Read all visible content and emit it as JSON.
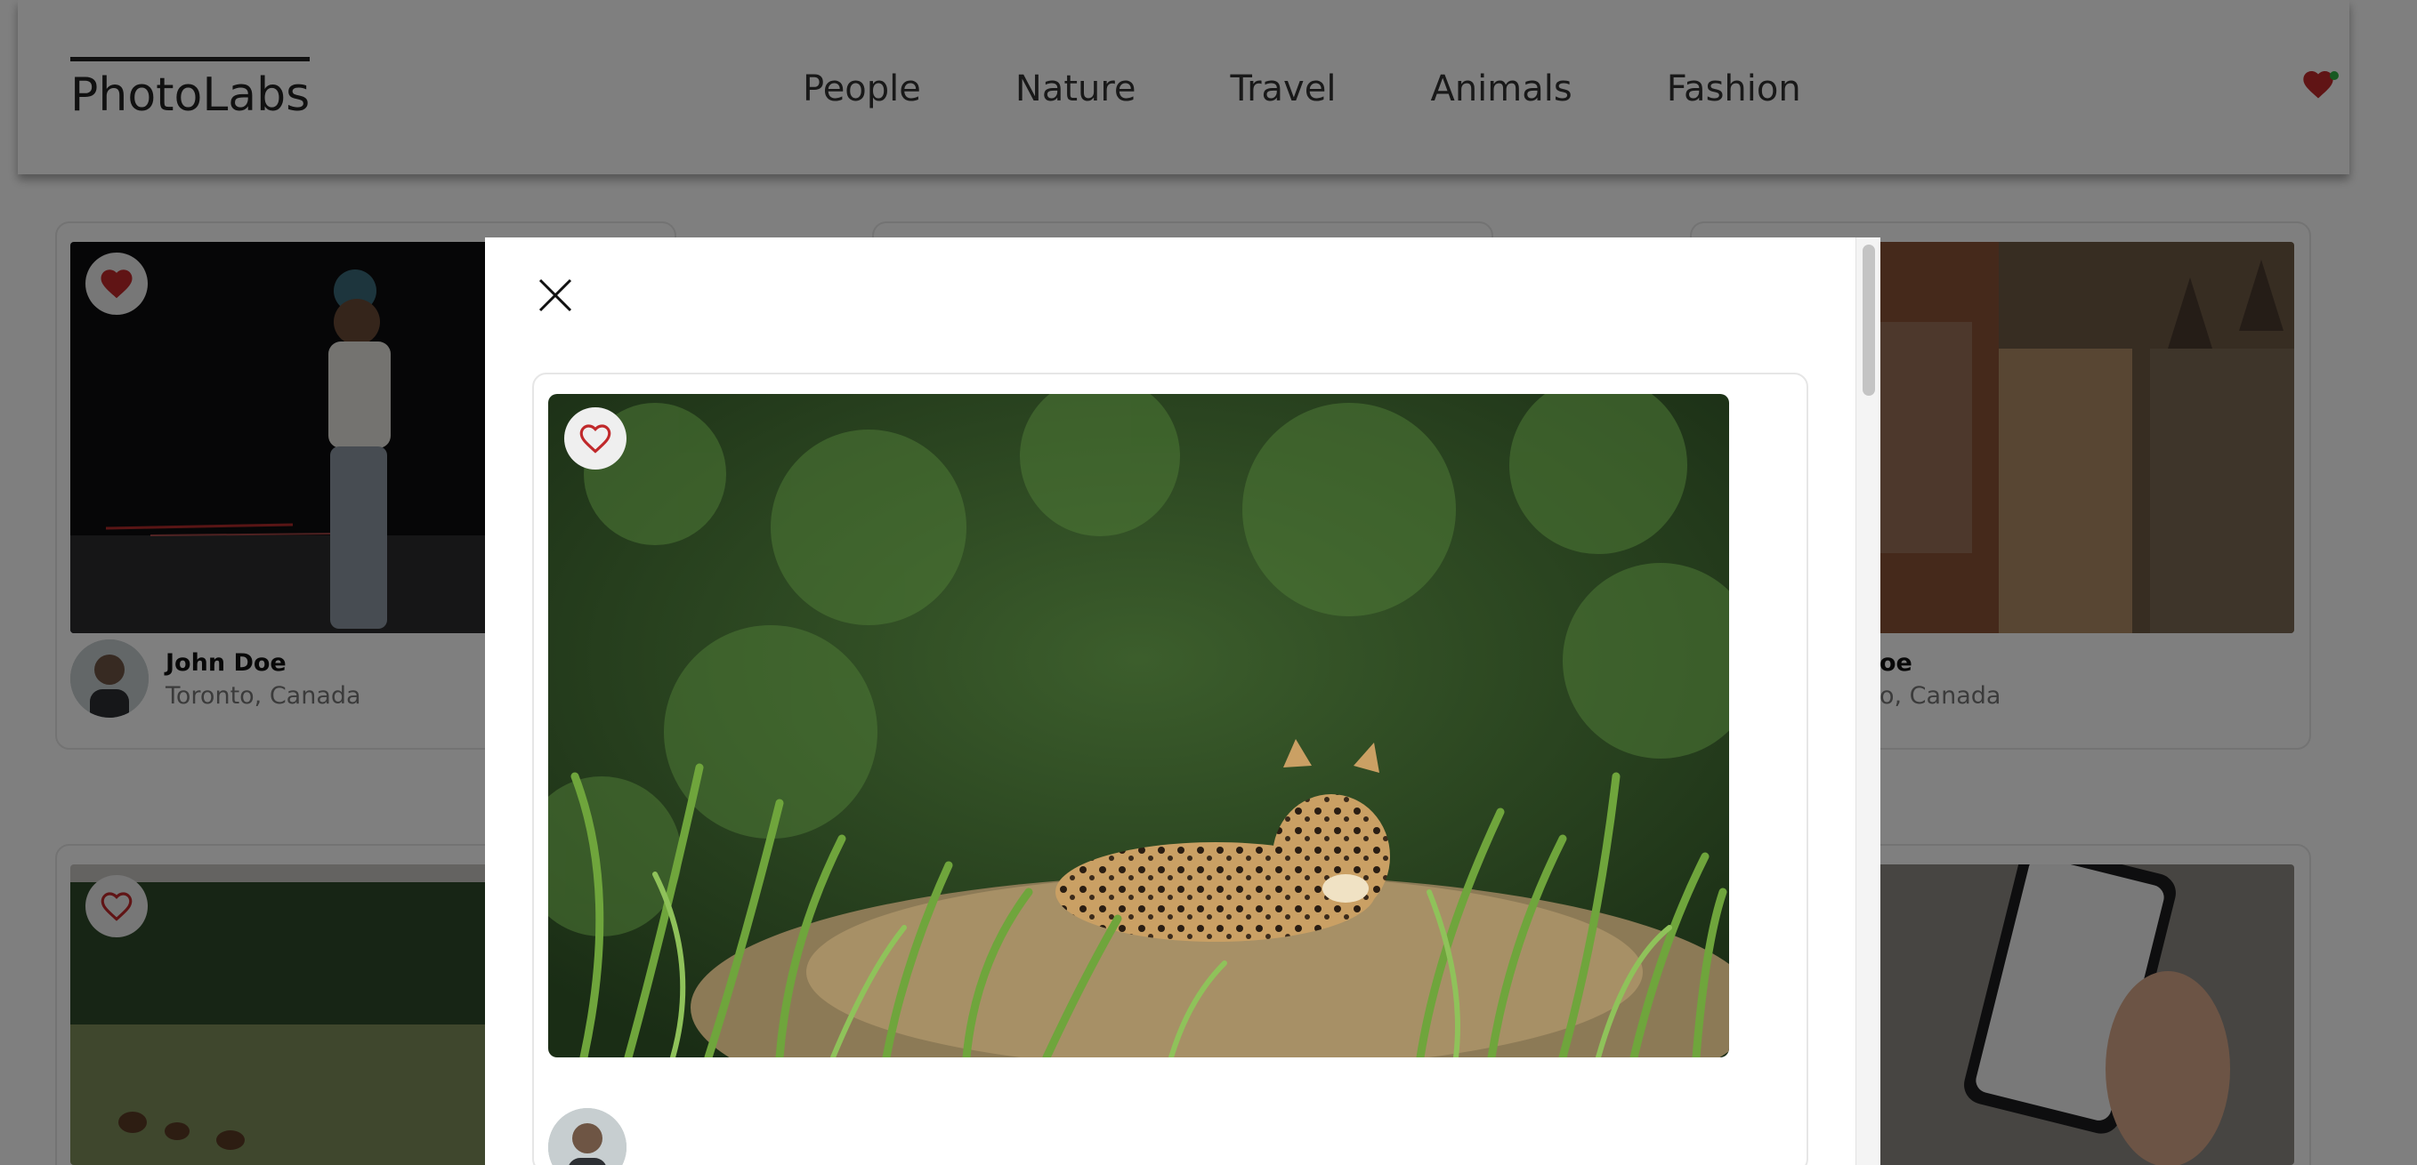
{
  "app": {
    "logo": "PhotoLabs"
  },
  "nav": {
    "topics": [
      "People",
      "Nature",
      "Travel",
      "Animals",
      "Fashion"
    ],
    "fav_icon": "heart-icon",
    "has_notification": true
  },
  "colors": {
    "heart_red": "#c0292b",
    "notify_green": "#2fb344",
    "text_dark": "#222222",
    "text_muted": "#777777"
  },
  "grid": {
    "cards": [
      {
        "user_name": "John Doe",
        "location": "Toronto, Canada",
        "favourited": true
      },
      {
        "user_name": "",
        "location": "",
        "favourited": false
      },
      {
        "user_name": "oe",
        "location": "o, Canada",
        "favourited": false
      },
      {
        "user_name": "",
        "location": "",
        "favourited": false
      },
      {
        "user_name": "",
        "location": "",
        "favourited": false
      },
      {
        "user_name": "",
        "location": "",
        "favourited": false
      }
    ]
  },
  "modal": {
    "close_icon": "close-icon",
    "photo_subject": "jaguar",
    "favourited": false
  }
}
